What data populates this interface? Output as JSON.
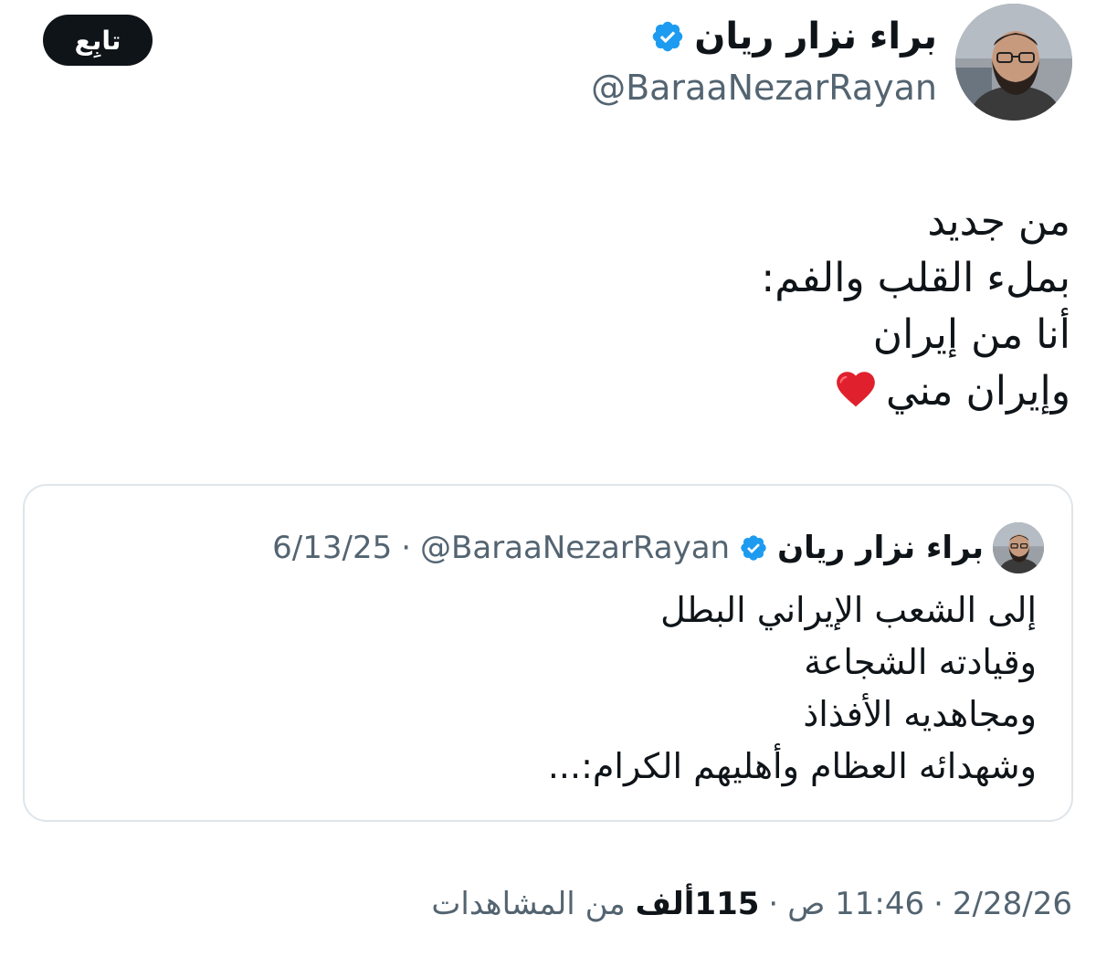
{
  "author": {
    "display_name": "براء نزار ريان",
    "handle": "@BaraaNezarRayan",
    "verified_icon": "verified-badge-icon"
  },
  "follow_button": {
    "label": "تابِع"
  },
  "tweet": {
    "lines": [
      "من جديد",
      "بملء القلب والفم:",
      "أنا من إيران",
      "وإيران مني"
    ],
    "emoji": "red-heart-icon"
  },
  "quoted_tweet": {
    "display_name": "براء نزار ريان",
    "handle": "@BaraaNezarRayan",
    "separator": "·",
    "date": "6/13/25",
    "lines": [
      "إلى الشعب الإيراني البطل",
      "وقيادته الشجاعة",
      "ومجاهديه الأفذاذ",
      "وشهدائه العظام وأهليهم الكرام:..."
    ]
  },
  "meta": {
    "date": "2/28/26",
    "separator": "·",
    "time": "11:46 ص",
    "views_count": "115ألف",
    "views_label": "من المشاهدات"
  },
  "colors": {
    "verified": "#1d9bf0",
    "secondary_text": "#536471",
    "primary_text": "#0f1419",
    "heart": "#e0202c"
  }
}
